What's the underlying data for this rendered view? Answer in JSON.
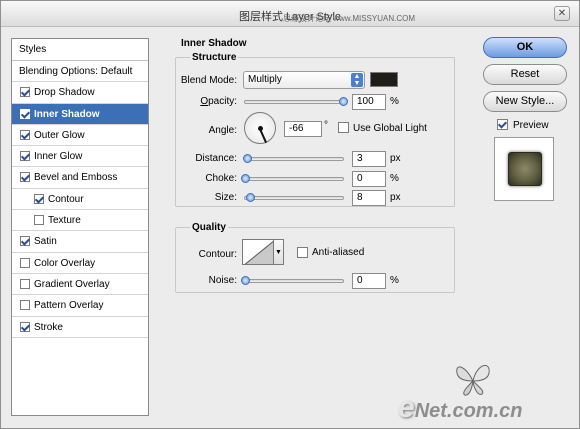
{
  "window": {
    "title": "图层样式 Layer Style",
    "watermark": "思缘设计论坛 www.MISSYUAN.COM",
    "close_label": "✕"
  },
  "styles_list": {
    "header": "Styles",
    "blending_options": "Blending Options: Default",
    "items": [
      {
        "label": "Drop Shadow",
        "checked": true
      },
      {
        "label": "Inner Shadow",
        "checked": true,
        "selected": true
      },
      {
        "label": "Outer Glow",
        "checked": true
      },
      {
        "label": "Inner Glow",
        "checked": true
      },
      {
        "label": "Bevel and Emboss",
        "checked": true
      },
      {
        "label": "Contour",
        "checked": true,
        "sub": true
      },
      {
        "label": "Texture",
        "checked": false,
        "sub": true
      },
      {
        "label": "Satin",
        "checked": true
      },
      {
        "label": "Color Overlay",
        "checked": false
      },
      {
        "label": "Gradient Overlay",
        "checked": false
      },
      {
        "label": "Pattern Overlay",
        "checked": false
      },
      {
        "label": "Stroke",
        "checked": true
      }
    ]
  },
  "inner_shadow": {
    "title": "Inner Shadow",
    "structure": {
      "title": "Structure",
      "blend_mode_label": "Blend Mode:",
      "blend_mode_value": "Multiply",
      "shadow_color": "#1e1d17",
      "opacity_label": "Opacity:",
      "opacity_value": "100",
      "opacity_unit": "%",
      "opacity_fraction": 1.0,
      "angle_label": "Angle:",
      "angle_value": "-66",
      "angle_unit": "°",
      "angle_degrees": -66,
      "use_global_light_label": "Use Global Light",
      "use_global_light_checked": false,
      "distance_label": "Distance:",
      "distance_value": "3",
      "distance_unit": "px",
      "distance_fraction": 0.02,
      "choke_label": "Choke:",
      "choke_value": "0",
      "choke_unit": "%",
      "choke_fraction": 0.0,
      "size_label": "Size:",
      "size_value": "8",
      "size_unit": "px",
      "size_fraction": 0.05
    },
    "quality": {
      "title": "Quality",
      "contour_label": "Contour:",
      "anti_aliased_label": "Anti-aliased",
      "anti_aliased_checked": false,
      "noise_label": "Noise:",
      "noise_value": "0",
      "noise_unit": "%",
      "noise_fraction": 0.0
    }
  },
  "buttons": {
    "ok": "OK",
    "reset": "Reset",
    "new_style": "New Style...",
    "preview_label": "Preview",
    "preview_checked": true
  },
  "branding": {
    "logo_e": "e",
    "logo_rest": "Net.com.cn"
  }
}
